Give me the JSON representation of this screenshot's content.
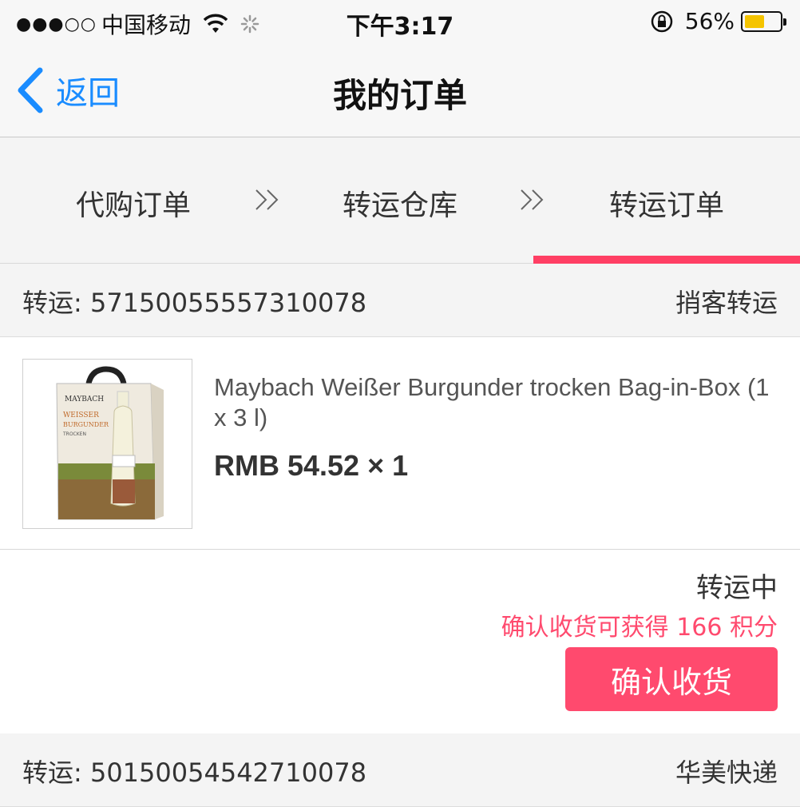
{
  "status_bar": {
    "signal": "●●●○○",
    "carrier": "中国移动",
    "time": "下午3:17",
    "battery_percent": "56%",
    "battery_level": 0.56,
    "icons": [
      "wifi-icon",
      "loading-spinner-icon",
      "rotation-lock-icon",
      "battery-icon"
    ]
  },
  "nav": {
    "back_label": "返回",
    "title": "我的订单"
  },
  "steps": {
    "items": [
      "代购订单",
      "转运仓库",
      "转运订单"
    ],
    "active_index": 2,
    "separator_icon": "double-chevron-right-icon",
    "indicator_color": "#ff3f64"
  },
  "orders": [
    {
      "label": "转运: 57150055557310078",
      "carrier": "捎客转运",
      "product": {
        "name": "Maybach Weißer Burgunder trocken Bag-in-Box (1 x 3 l)",
        "price": "RMB 54.52 × 1",
        "image_icon": "wine-bag-in-box-product-image",
        "image_text": "MAYBACH WEISSER BURGUNDER TROCKEN"
      },
      "status": "转运中",
      "points_note": "确认收货可获得 166 积分",
      "confirm_label": "确认收货"
    },
    {
      "label": "转运: 50150054542710078",
      "carrier": "华美快递"
    }
  ],
  "colors": {
    "accent": "#ff4a6e",
    "link": "#1a8cff"
  }
}
